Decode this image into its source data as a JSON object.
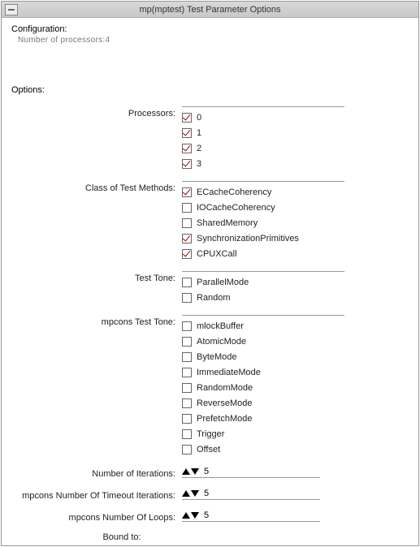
{
  "window": {
    "title": "mp(mptest) Test Parameter Options"
  },
  "config": {
    "label": "Configuration:",
    "line1": "Number of processors:4"
  },
  "options_label": "Options:",
  "sections": {
    "processors": {
      "label": "Processors:",
      "items": [
        {
          "label": "0",
          "checked": true
        },
        {
          "label": "1",
          "checked": true
        },
        {
          "label": "2",
          "checked": true
        },
        {
          "label": "3",
          "checked": true
        }
      ]
    },
    "class_methods": {
      "label": "Class of Test Methods:",
      "items": [
        {
          "label": "ECacheCoherency",
          "checked": true
        },
        {
          "label": "IOCacheCoherency",
          "checked": false
        },
        {
          "label": "SharedMemory",
          "checked": false
        },
        {
          "label": "SynchronizationPrimitives",
          "checked": true
        },
        {
          "label": "CPUXCall",
          "checked": true
        }
      ]
    },
    "test_tone": {
      "label": "Test Tone:",
      "items": [
        {
          "label": "ParallelMode",
          "checked": false
        },
        {
          "label": "Random",
          "checked": false
        }
      ]
    },
    "mpcons_tone": {
      "label": "mpcons Test Tone:",
      "items": [
        {
          "label": "mlockBuffer",
          "checked": false
        },
        {
          "label": "AtomicMode",
          "checked": false
        },
        {
          "label": "ByteMode",
          "checked": false
        },
        {
          "label": "ImmediateMode",
          "checked": false
        },
        {
          "label": "RandomMode",
          "checked": false
        },
        {
          "label": "ReverseMode",
          "checked": false
        },
        {
          "label": "PrefetchMode",
          "checked": false
        },
        {
          "label": "Trigger",
          "checked": false
        },
        {
          "label": "Offset",
          "checked": false
        }
      ]
    }
  },
  "spinners": {
    "iterations": {
      "label": "Number of Iterations:",
      "value": "5"
    },
    "timeout": {
      "label": "mpcons Number Of Timeout Iterations:",
      "value": "5"
    },
    "loops": {
      "label": "mpcons Number Of Loops:",
      "value": "5"
    }
  },
  "roundto": {
    "label": "Bound to:"
  }
}
